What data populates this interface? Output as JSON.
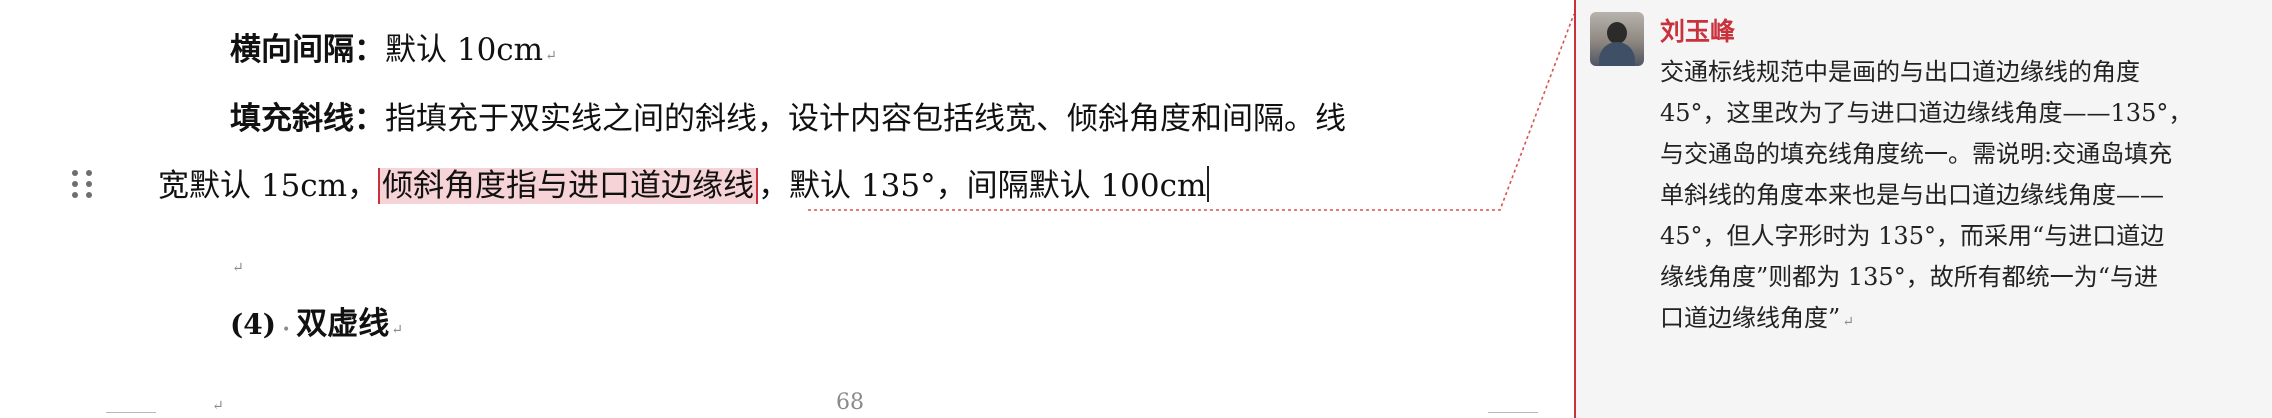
{
  "document": {
    "line1": {
      "label": "横向间隔：",
      "text": "默认 10cm"
    },
    "line2": {
      "label": "填充斜线：",
      "text": "指填充于双实线之间的斜线，设计内容包括线宽、倾斜角度和间隔。线"
    },
    "line3": {
      "before": "宽默认 15cm，",
      "highlighted": "倾斜角度指与进口道边缘线",
      "after": "，默认 135°，间隔默认 100cm"
    },
    "heading": {
      "number": "(4)",
      "title": "双虚线"
    },
    "page_number": "68",
    "paragraph_mark": "↵"
  },
  "comment": {
    "author": "刘玉峰",
    "lines": [
      "交通标线规范中是画的与出口道边缘线的角度",
      "45°，这里改为了与进口道边缘线角度——135°，",
      "与交通岛的填充线角度统一。需说明:交通岛填充",
      "单斜线的角度本来也是与出口道边缘线角度——",
      "45°，但人字形时为 135°，而采用“与进口道边",
      "缘线角度”则都为 135°，故所有都统一为“与进",
      "口道边缘线角度”"
    ],
    "accent_color": "#c9323c"
  },
  "colors": {
    "highlight_bg": "#f6d3d6",
    "comment_bg": "#f5f5f5"
  },
  "icons": {
    "drag_handle": "drag-handle-icon",
    "avatar": "user-avatar"
  }
}
